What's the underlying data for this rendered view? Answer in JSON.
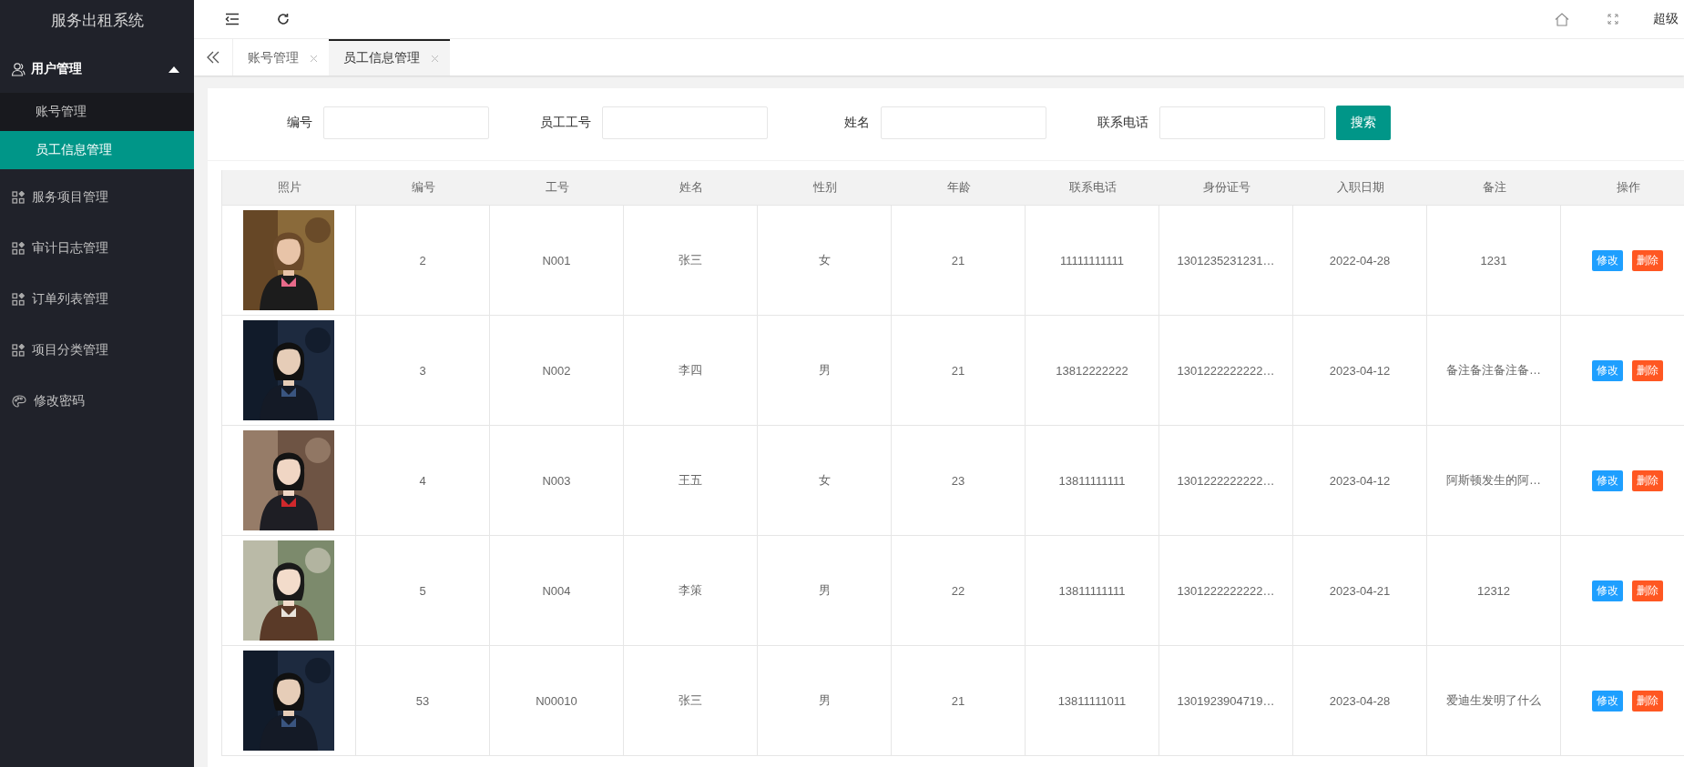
{
  "sidebar": {
    "title": "服务出租系统",
    "items": [
      {
        "label": "用户管理",
        "kind": "user",
        "expanded": true,
        "children": [
          {
            "label": "账号管理",
            "selected": false
          },
          {
            "label": "员工信息管理",
            "selected": true
          }
        ]
      },
      {
        "label": "服务项目管理",
        "kind": "grid"
      },
      {
        "label": "审计日志管理",
        "kind": "grid"
      },
      {
        "label": "订单列表管理",
        "kind": "grid"
      },
      {
        "label": "项目分类管理",
        "kind": "grid"
      },
      {
        "label": "修改密码",
        "kind": "palette"
      }
    ]
  },
  "header": {
    "user": "超级"
  },
  "tabs": [
    {
      "label": "账号管理",
      "selected": false
    },
    {
      "label": "员工信息管理",
      "selected": true
    }
  ],
  "search": {
    "fields": [
      {
        "label": "编号"
      },
      {
        "label": "员工工号"
      },
      {
        "label": "姓名"
      },
      {
        "label": "联系电话"
      }
    ],
    "button": "搜索"
  },
  "table": {
    "photo_column": "照片",
    "columns": [
      "编号",
      "工号",
      "姓名",
      "性别",
      "年龄",
      "联系电话",
      "身份证号",
      "入职日期",
      "备注"
    ],
    "action_column": "操作",
    "rows": [
      {
        "cells": [
          "2",
          "N001",
          "张三",
          "女",
          "21",
          "11111111111",
          "1301235231231…",
          "2022-04-28",
          "1231"
        ],
        "actions": [
          "修改",
          "删除"
        ]
      },
      {
        "cells": [
          "3",
          "N002",
          "李四",
          "男",
          "21",
          "13812222222",
          "1301222222222…",
          "2023-04-12",
          "备注备注备注备…"
        ],
        "actions": [
          "修改",
          "删除"
        ]
      },
      {
        "cells": [
          "4",
          "N003",
          "王五",
          "女",
          "23",
          "13811111111",
          "1301222222222…",
          "2023-04-12",
          "阿斯顿发生的阿…"
        ],
        "actions": [
          "修改",
          "删除"
        ]
      },
      {
        "cells": [
          "5",
          "N004",
          "李策",
          "男",
          "22",
          "13811111111",
          "1301222222222…",
          "2023-04-21",
          "12312"
        ],
        "actions": [
          "修改",
          "删除"
        ]
      },
      {
        "cells": [
          "53",
          "N00010",
          "张三",
          "男",
          "21",
          "13811111011",
          "1301923904719…",
          "2023-04-28",
          "爱迪生发明了什么"
        ],
        "actions": [
          "修改",
          "删除"
        ]
      }
    ]
  }
}
